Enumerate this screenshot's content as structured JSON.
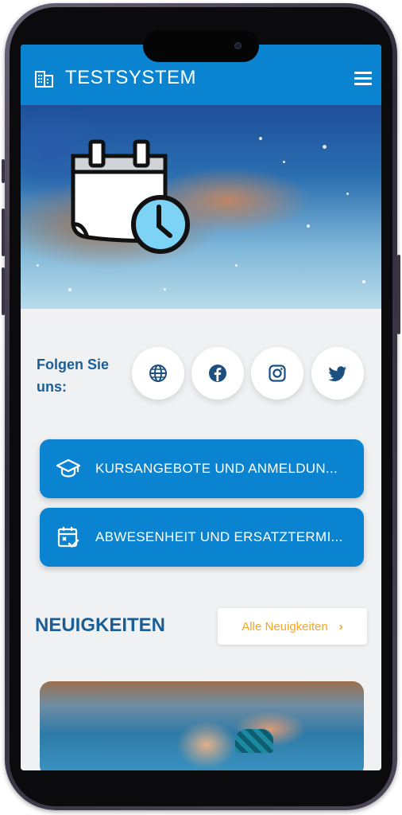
{
  "app": {
    "title": "TESTSYSTEM"
  },
  "header": {
    "logo_icon": "building-icon",
    "menu_icon": "hamburger-menu-icon"
  },
  "hero": {
    "illustration_icon": "calendar-clock-icon"
  },
  "follow": {
    "label": "Folgen Sie uns:",
    "social": [
      {
        "name": "website",
        "icon": "globe-icon"
      },
      {
        "name": "facebook",
        "icon": "facebook-icon"
      },
      {
        "name": "instagram",
        "icon": "instagram-icon"
      },
      {
        "name": "twitter",
        "icon": "twitter-icon"
      }
    ]
  },
  "actions": [
    {
      "label": "KURSANGEBOTE UND ANMELDUN...",
      "icon": "graduation-cap-icon"
    },
    {
      "label": "ABWESENHEIT UND ERSATZTERMI...",
      "icon": "calendar-check-icon"
    }
  ],
  "news": {
    "title": "NEUIGKEITEN",
    "all_label": "Alle Neuigkeiten",
    "all_icon": "chevron-right-icon"
  },
  "colors": {
    "primary": "#0a84d0",
    "heading": "#1b5e96",
    "accent": "#f5a623",
    "background": "#f0f1f3"
  }
}
